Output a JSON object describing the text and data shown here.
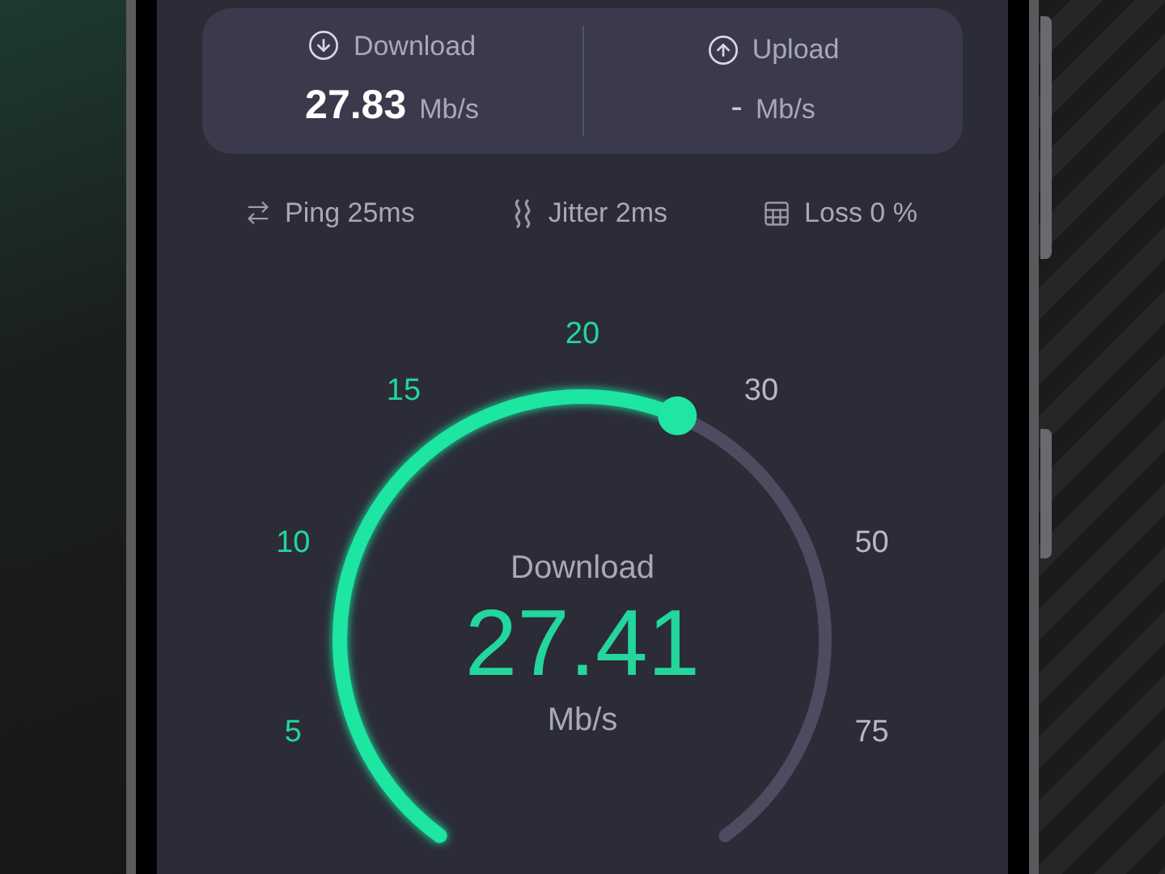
{
  "summary": [
    {
      "kind": "download",
      "label": "Download",
      "value": "27.83",
      "unit": "Mb/s"
    },
    {
      "kind": "upload",
      "label": "Upload",
      "value": "-",
      "unit": "Mb/s"
    }
  ],
  "stats": [
    {
      "kind": "ping",
      "label": "Ping 25ms"
    },
    {
      "kind": "jitter",
      "label": "Jitter 2ms"
    },
    {
      "kind": "loss",
      "label": "Loss 0 %"
    }
  ],
  "gauge": {
    "label": "Download",
    "value": "27.41",
    "unit": "Mb/s",
    "ticks": [
      {
        "label": "5",
        "reached": true
      },
      {
        "label": "10",
        "reached": true
      },
      {
        "label": "15",
        "reached": true
      },
      {
        "label": "20",
        "reached": true
      },
      {
        "label": "30",
        "reached": false
      },
      {
        "label": "50",
        "reached": false
      },
      {
        "label": "75",
        "reached": false
      }
    ]
  }
}
